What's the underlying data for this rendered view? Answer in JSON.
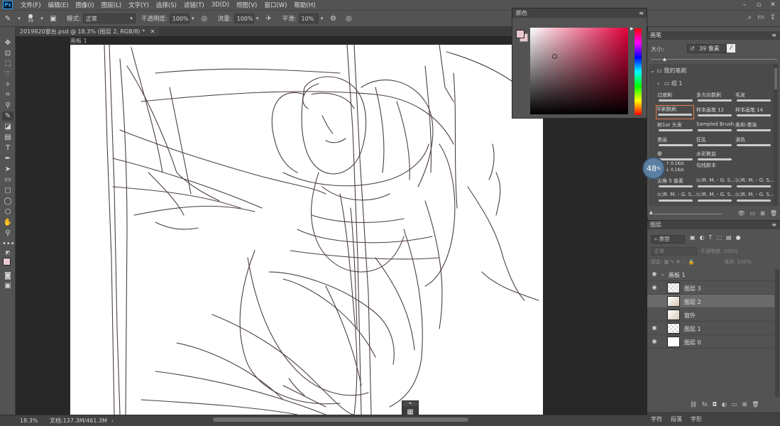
{
  "menubar": {
    "logo": "Ps",
    "items": [
      "文件(F)",
      "编辑(E)",
      "图像(I)",
      "图层(L)",
      "文字(Y)",
      "选择(S)",
      "滤镜(T)",
      "3D(D)",
      "视图(V)",
      "窗口(W)",
      "帮助(H)"
    ]
  },
  "options": {
    "brush_size": "39",
    "mode_label": "模式:",
    "mode_value": "正常",
    "opacity_label": "不透明度:",
    "opacity_value": "100%",
    "flow_label": "流量:",
    "flow_value": "100%",
    "smoothing_label": "平滑:",
    "smoothing_value": "10%"
  },
  "document": {
    "tab_title": "2019820窗台.psd @ 18.3% (图层 2, RGB/8) *",
    "artboard_label": "画板 1"
  },
  "color_panel": {
    "title": "颜色",
    "foreground": "#e9c9cf",
    "hue": "#e3003c"
  },
  "brushes_panel": {
    "title": "画笔",
    "size_label": "大小:",
    "size_value": "39 像素",
    "folder": "我的笔刷",
    "subfolder": "组 1",
    "brushes": [
      [
        "过度刷",
        "多方向数刷",
        "毛发"
      ],
      [
        "平刷数刷",
        "样本画笔 12",
        "样本画笔 14"
      ],
      [
        "树1or 头发",
        "Sampled Brush...",
        "柔和-墨染"
      ],
      [
        "墨画",
        "狂乱",
        "滴色"
      ],
      [
        "晕",
        "水彩數盐",
        ""
      ],
      [
        "",
        "勾线新本",
        ""
      ],
      [
        "尖角 5 像素",
        "(c)R. M. - G. S...",
        "(c)R. M. - G. S..."
      ],
      [
        "(c)R. M. - G. S...",
        "(c)R. M. - G. S...",
        "(c)R. M. - G. S..."
      ]
    ],
    "selected": "平刷数刷"
  },
  "overlay": {
    "zoom_badge": "48",
    "zoom_unit": "%",
    "upload": "0.1K/s",
    "download": "0.1K/s"
  },
  "layers_panel": {
    "title": "图层",
    "filter": "类型",
    "blend": "正常",
    "opacity_label": "不透明度:",
    "opacity_value": "100%",
    "lock_label": "锁定:",
    "fill_label": "填充:",
    "fill_value": "100%",
    "layers": [
      {
        "name": "画板 1",
        "type": "group",
        "visible": true
      },
      {
        "name": "图层 3",
        "type": "transparent",
        "visible": true
      },
      {
        "name": "图层 2",
        "type": "art",
        "visible": false,
        "selected": true
      },
      {
        "name": "窗外",
        "type": "art",
        "visible": false
      },
      {
        "name": "图层 1",
        "type": "transparent",
        "visible": true
      },
      {
        "name": "图层 0",
        "type": "white",
        "visible": true
      }
    ]
  },
  "bottom_tabs": [
    "字符",
    "段落",
    "字形"
  ],
  "status": {
    "zoom": "18.3%",
    "doc_info": "文档:137.3M/461.3M"
  }
}
